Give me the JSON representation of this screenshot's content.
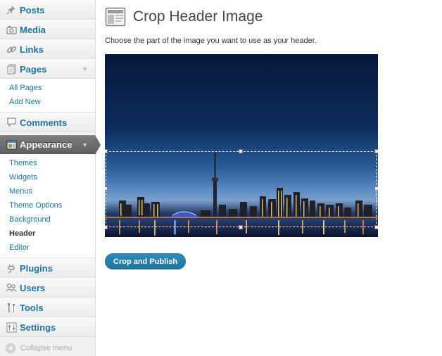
{
  "sidebar": {
    "items": [
      {
        "label": "Posts",
        "icon": "pushpin-icon"
      },
      {
        "label": "Media",
        "icon": "media-icon"
      },
      {
        "label": "Links",
        "icon": "link-icon"
      },
      {
        "label": "Pages",
        "icon": "pages-icon",
        "submenu": [
          "All Pages",
          "Add New"
        ]
      },
      {
        "label": "Comments",
        "icon": "comment-icon"
      },
      {
        "label": "Appearance",
        "icon": "appearance-icon",
        "submenu": [
          "Themes",
          "Widgets",
          "Menus",
          "Theme Options",
          "Background",
          "Header",
          "Editor"
        ],
        "active_sub": "Header"
      },
      {
        "label": "Plugins",
        "icon": "plugin-icon"
      },
      {
        "label": "Users",
        "icon": "users-icon"
      },
      {
        "label": "Tools",
        "icon": "tools-icon"
      },
      {
        "label": "Settings",
        "icon": "settings-icon"
      }
    ],
    "collapse_label": "Collapse menu"
  },
  "main": {
    "title": "Crop Header Image",
    "instructions": "Choose the part of the image you want to use as your header.",
    "button_label": "Crop and Publish"
  },
  "colors": {
    "link": "#21759b",
    "current_menu": "#6a6a6a",
    "button": "#21759b"
  }
}
